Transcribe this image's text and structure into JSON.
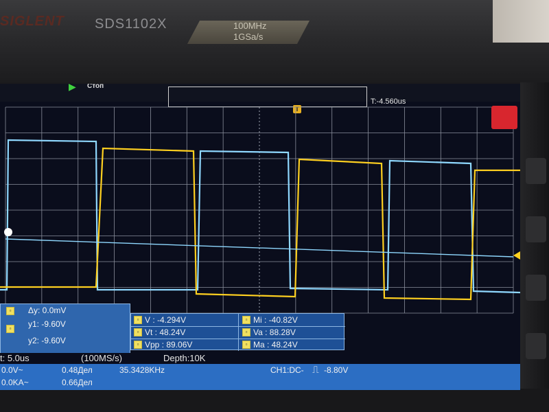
{
  "device": {
    "brand": "SIGLENT",
    "model": "SDS1102X",
    "spec_bandwidth": "100MHz",
    "spec_samplerate": "1GSa/s"
  },
  "screen": {
    "trigger_status": "Стоп",
    "time_offset": "T:-4.560us",
    "trigger_marker": "T"
  },
  "cursors": {
    "delta_y": "Δy: 0.0mV",
    "y1": "y1: -9.60V",
    "y2": "y2: -9.60V"
  },
  "measurements": {
    "v": "V : -4.294V",
    "vt": "Vt : 48.24V",
    "vpp": "Vpp : 89.06V",
    "mi": "Mi : -40.82V",
    "va": "Va : 88.28V",
    "ma": "Ma : 48.24V"
  },
  "status": {
    "timebase": "t: 5.0us",
    "sample_rate": "(100MS/s)",
    "depth": "Depth:10K"
  },
  "info_bar": {
    "ch1_offset": "0.0V~",
    "ch1_reading": "0.48Дел",
    "frequency": "35.3428KHz",
    "ch2_offset": "0.0KA~",
    "ch2_reading": "0.66Дел",
    "trigger_info": "CH1:DC-",
    "trigger_level": "-8.80V"
  },
  "colors": {
    "ch1": "#8fd8ff",
    "ch2": "#ffd020",
    "grid": "#8a8f9c",
    "panel": "#2f66ad",
    "info_bar": "#2c6ec3"
  },
  "waveforms": {
    "ch1": {
      "type": "square",
      "duty": 0.85,
      "color_name": "light-blue"
    },
    "ch2": {
      "type": "square",
      "duty": 0.85,
      "color_name": "yellow"
    }
  }
}
